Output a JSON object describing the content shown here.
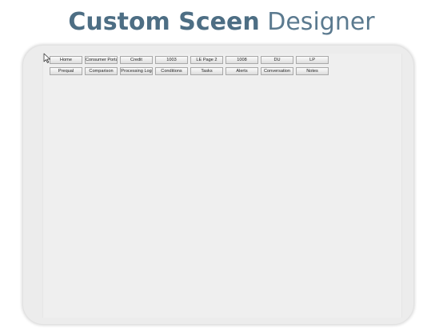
{
  "title": {
    "bold_part": "Custom Sceen",
    "light_part": "Designer"
  },
  "tabs_row1": [
    "Home",
    "Consumer Portal",
    "Credit",
    "1003",
    "LE Page 2",
    "1008",
    "DU",
    "LP"
  ],
  "tabs_row2": [
    "Prequal",
    "Comparison",
    "Processing Log",
    "Conditions",
    "Tasks",
    "Alerts",
    "Conversation",
    "Notes"
  ],
  "colors": {
    "title": "#4d6e84",
    "frame": "#ececec",
    "tab_border": "#a9a9a9"
  },
  "icons": [
    "mouse-pointer-icon"
  ]
}
